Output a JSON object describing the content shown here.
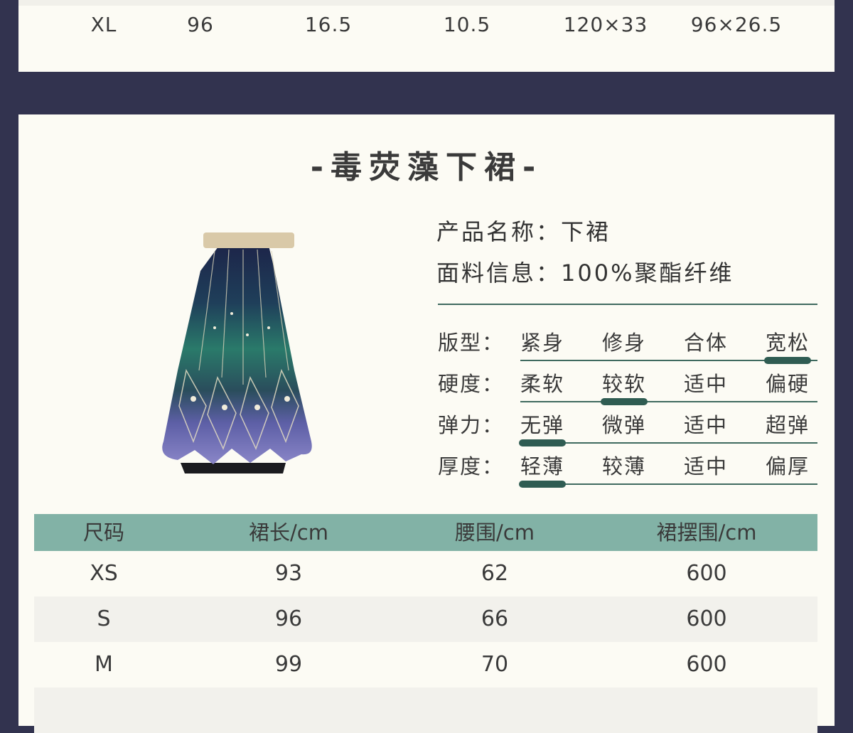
{
  "top_table": {
    "last_row": [
      "XL",
      "96",
      "16.5",
      "10.5",
      "120×33",
      "96×26.5"
    ]
  },
  "product": {
    "section_title": "-毒荧藻下裙-",
    "name_line": "产品名称：下裙",
    "fabric_line": "面料信息：100%聚酯纤维"
  },
  "attributes": [
    {
      "label": "版型：",
      "options": [
        "紧身",
        "修身",
        "合体",
        "宽松"
      ],
      "selected": 3
    },
    {
      "label": "硬度：",
      "options": [
        "柔软",
        "较软",
        "适中",
        "偏硬"
      ],
      "selected": 1
    },
    {
      "label": "弹力：",
      "options": [
        "无弹",
        "微弹",
        "适中",
        "超弹"
      ],
      "selected": 0
    },
    {
      "label": "厚度：",
      "options": [
        "轻薄",
        "较薄",
        "适中",
        "偏厚"
      ],
      "selected": 0
    }
  ],
  "size_table": {
    "headers": [
      "尺码",
      "裙长/cm",
      "腰围/cm",
      "裙摆围/cm"
    ],
    "rows": [
      [
        "XS",
        "93",
        "62",
        "600"
      ],
      [
        "S",
        "96",
        "66",
        "600"
      ],
      [
        "M",
        "99",
        "70",
        "600"
      ]
    ]
  },
  "colors": {
    "page_background": "#32334f",
    "card_background": "#fcfbf4",
    "accent_green": "#2f5c52",
    "table_header": "#82b2a6"
  }
}
